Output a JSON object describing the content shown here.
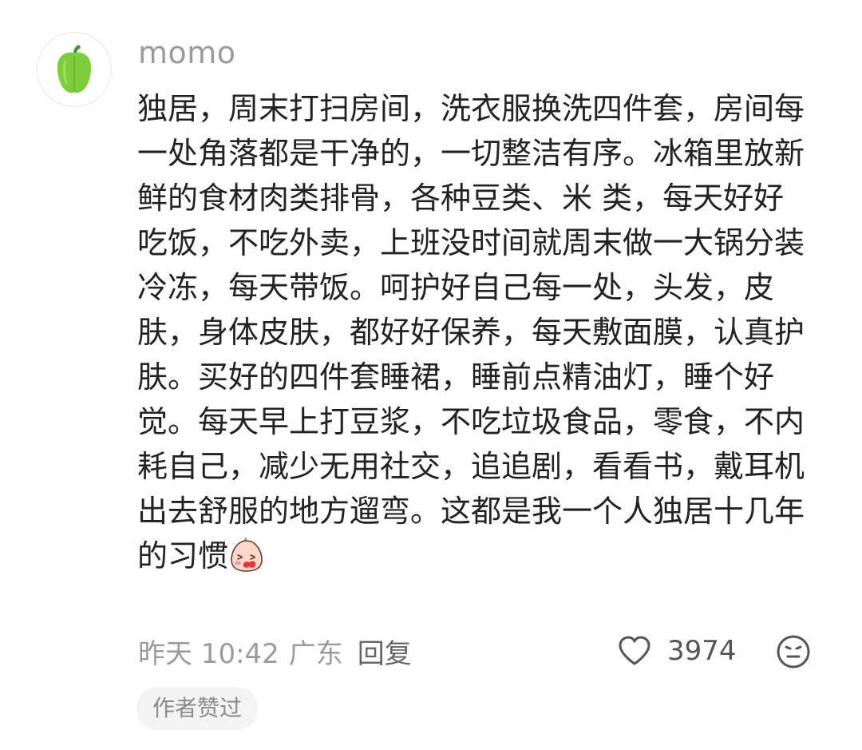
{
  "comment": {
    "username": "momo",
    "text": "独居，周末打扫房间，洗衣服换洗四件套，房间每一处角落都是干净的，一切整洁有序。冰箱里放新鲜的食材肉类排骨，各种豆类、米 类，每天好好吃饭，不吃外卖，上班没时间就周末做一大锅分装冷冻，每天带饭。呵护好自己每一处，头发，皮肤，身体皮肤，都好好保养，每天敷面膜，认真护肤。买好的四件套睡裙，睡前点精油灯，睡个好觉。每天早上打豆浆，不吃垃圾食品，零食，不内耗自己，减少无用社交，追追剧，看看书，戴耳机出去舒服的地方遛弯。这都是我一个人独居十几年的习惯",
    "inline_emoji": "blushing-egg-emoji",
    "avatar_icon": "green-pepper-icon",
    "time": "昨天 10:42",
    "location": "广东",
    "reply_label": "回复",
    "like_icon": "heart-outline-icon",
    "like_count": "3974",
    "dislike_icon": "frown-face-icon",
    "author_badge": "作者赞过"
  },
  "colors": {
    "username": "#9b9b9b",
    "body_text": "#222222",
    "meta": "#9b9b9b",
    "badge_bg": "#f3f3f3",
    "pepper_green": "#7ccd3a"
  }
}
